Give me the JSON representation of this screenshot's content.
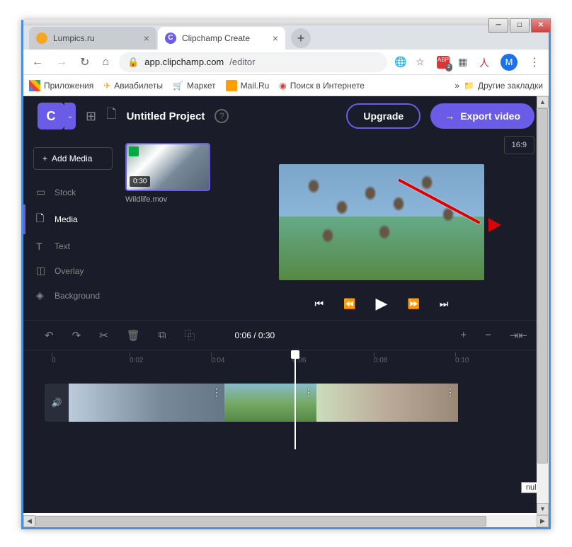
{
  "window": {
    "tabs": [
      {
        "title": "Lumpics.ru",
        "active": false
      },
      {
        "title": "Clipchamp Create",
        "active": true
      }
    ]
  },
  "browser": {
    "url_host": "app.clipchamp.com",
    "url_path": "/editor",
    "avatar_letter": "M",
    "bookmarks": {
      "apps": "Приложения",
      "flights": "Авиабилеты",
      "market": "Маркет",
      "mail": "Mail.Ru",
      "search": "Поиск в Интернете",
      "other": "Другие закладки",
      "more": "»"
    }
  },
  "app": {
    "logo": "C",
    "project_title": "Untitled Project",
    "upgrade": "Upgrade",
    "export": "Export video",
    "add_media": "Add Media",
    "aspect": "16:9",
    "sidebar": {
      "stock": "Stock",
      "media": "Media",
      "text": "Text",
      "overlay": "Overlay",
      "background": "Background"
    },
    "media_item": {
      "duration": "0:30",
      "name": "Wildlife.mov"
    },
    "timeline": {
      "time": "0:06 / 0:30",
      "marks": [
        "0",
        "0:02",
        "0:04",
        "0:06",
        "0:08",
        "0:10"
      ]
    },
    "tooltip": "null"
  }
}
